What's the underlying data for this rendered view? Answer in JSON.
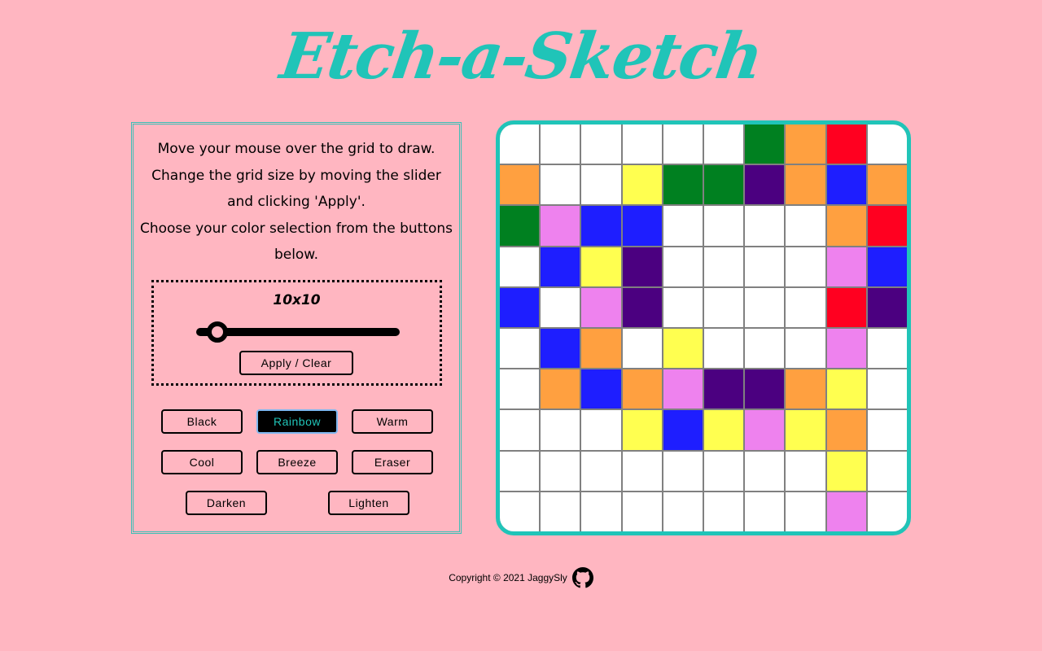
{
  "title": "Etch-a-Sketch",
  "instructions": [
    "Move your mouse over the grid to draw.",
    "Change the grid size by moving the slider and clicking 'Apply'.",
    "Choose your color selection from the buttons below."
  ],
  "grid_size": {
    "label": "10x10",
    "value": 10,
    "min": 2,
    "max": 100
  },
  "apply_label": "Apply / Clear",
  "color_buttons": {
    "black": "Black",
    "rainbow": "Rainbow",
    "warm": "Warm",
    "cool": "Cool",
    "breeze": "Breeze",
    "eraser": "Eraser",
    "darken": "Darken",
    "lighten": "Lighten",
    "active": "rainbow"
  },
  "palette": {
    "W": "#ffffff",
    "G": "#008020",
    "O": "#ffa040",
    "R": "#ff0020",
    "Y": "#ffff50",
    "P": "#4b0080",
    "B": "#1e1eff",
    "V": "#ee82ee"
  },
  "grid_colors": [
    "WWWWWWGORW",
    "OWWYGGPOBO",
    "GVBBWWWWOR",
    "WBYPWWWWVB",
    "BWVPWWWWRP",
    "WBOWYWWWVW",
    "WOBOVPPOYW",
    "WWWYBYVYOW",
    "WWWWWWWWYW",
    "WWWWWWWWVW"
  ],
  "accent_color": "#20c4b8",
  "background_color": "#ffb6c1",
  "footer": {
    "copyright": "Copyright © 2021 JaggySly",
    "icon": "github-icon"
  }
}
